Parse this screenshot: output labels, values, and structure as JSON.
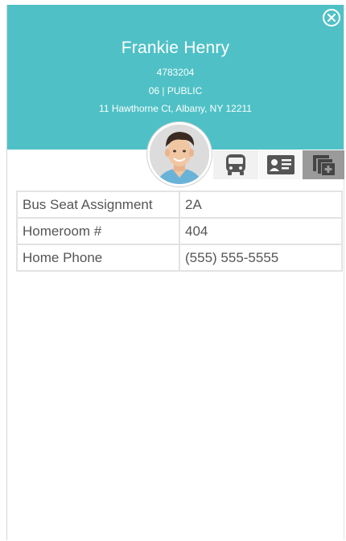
{
  "student": {
    "name": "Frankie Henry",
    "id": "4783204",
    "grade_type": "06 | PUBLIC",
    "address": "11 Hawthorne Ct, Albany, NY 12211"
  },
  "icons": {
    "close": "close-circle-icon",
    "bus": "bus-icon",
    "card": "id-card-icon",
    "add": "copy-add-icon"
  },
  "colors": {
    "header": "#4fc1c6",
    "active_tab": "#9a9a9a"
  },
  "details": [
    {
      "label": "Bus Seat Assignment",
      "value": "2A"
    },
    {
      "label": "Homeroom #",
      "value": "404"
    },
    {
      "label": "Home Phone",
      "value": "(555) 555-5555"
    }
  ]
}
